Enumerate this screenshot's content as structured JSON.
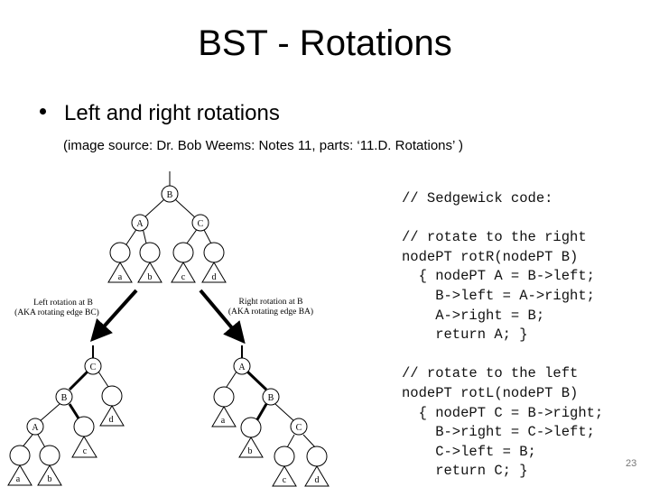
{
  "slide": {
    "title": "BST - Rotations",
    "bullet": "Left and right rotations",
    "source": "(image source: Dr. Bob Weems:  Notes 11, parts: ‘11.D. Rotations’ )",
    "page_number": "23"
  },
  "diagram": {
    "top_tree": {
      "root": "B",
      "left": "A",
      "right": "C",
      "subtrees": [
        "a",
        "b",
        "c",
        "d"
      ]
    },
    "left_rotation_label_1": "Left rotation at B",
    "left_rotation_label_2": "(AKA rotating edge BC)",
    "right_rotation_label_1": "Right rotation at B",
    "right_rotation_label_2": "(AKA rotating edge BA)",
    "left_result": {
      "root": "C",
      "mid": "B",
      "low": "A",
      "subtrees": [
        "a",
        "b",
        "c",
        "d"
      ]
    },
    "right_result": {
      "root": "A",
      "mid": "B",
      "low": "C",
      "subtrees": [
        "a",
        "b",
        "c",
        "d"
      ]
    }
  },
  "code": {
    "lines": [
      "// Sedgewick code:",
      "",
      "// rotate to the right",
      "nodePT rotR(nodePT B)",
      "  { nodePT A = B->left;",
      "    B->left = A->right;",
      "    A->right = B;",
      "    return A; }",
      "",
      "// rotate to the left",
      "nodePT rotL(nodePT B)",
      "  { nodePT C = B->right;",
      "    B->right = C->left;",
      "    C->left = B;",
      "    return C; }"
    ]
  }
}
